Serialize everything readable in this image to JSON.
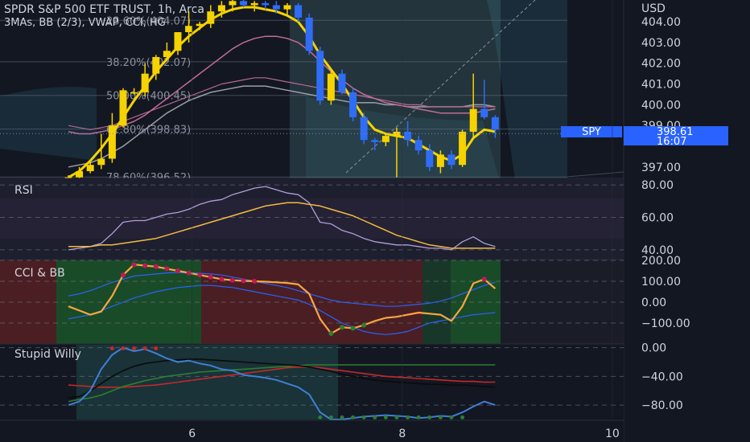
{
  "symbol": {
    "title": "SPDR S&P 500 ETF TRUST, 1h, Arca",
    "indicators": "3MAs, BB (2/3), VWAP, CCI, HG"
  },
  "currency": "USD",
  "price_axis": {
    "labels": [
      "404.00",
      "403.00",
      "402.00",
      "401.00",
      "400.00",
      "399.00",
      "397.00"
    ],
    "values": [
      404,
      403,
      402,
      401,
      400,
      399,
      397
    ],
    "ylim": [
      396.45,
      405.05
    ]
  },
  "fib_levels": [
    {
      "label": "23.60%(404.07)",
      "value": 404.07
    },
    {
      "label": "38.20%(402.07)",
      "value": 402.07
    },
    {
      "label": "50.00%(400.45)",
      "value": 400.45
    },
    {
      "label": "61.80%(398.83)",
      "value": 398.83
    },
    {
      "label": "78.60%(396.52)",
      "value": 396.52
    }
  ],
  "last_price": {
    "ticker": "SPY",
    "price": "398.61",
    "countdown": "16:07",
    "value": 398.61,
    "color": "#2962ff"
  },
  "candles": {
    "up_color": "#f5d300",
    "down_color": "#2f6df6",
    "ohlc": [
      [
        396.3,
        396.6,
        396.0,
        396.5
      ],
      [
        396.5,
        397.0,
        396.3,
        396.8
      ],
      [
        396.8,
        397.3,
        396.7,
        397.1
      ],
      [
        397.1,
        398.6,
        396.9,
        397.4
      ],
      [
        397.4,
        399.6,
        397.2,
        399.0
      ],
      [
        399.0,
        400.8,
        398.9,
        400.7
      ],
      [
        400.6,
        400.8,
        400.5,
        400.6
      ],
      [
        400.6,
        402.0,
        400.4,
        401.5
      ],
      [
        401.5,
        402.4,
        401.2,
        402.3
      ],
      [
        402.3,
        403.0,
        402.1,
        402.6
      ],
      [
        402.6,
        403.5,
        402.4,
        403.5
      ],
      [
        403.5,
        404.5,
        403.0,
        403.8
      ],
      [
        403.8,
        404.0,
        403.6,
        403.9
      ],
      [
        403.9,
        404.8,
        403.7,
        404.5
      ],
      [
        404.5,
        405.0,
        404.2,
        404.8
      ],
      [
        404.8,
        405.1,
        404.5,
        405.0
      ],
      [
        405.0,
        405.1,
        404.7,
        404.8
      ],
      [
        404.8,
        405.0,
        404.5,
        404.9
      ],
      [
        404.9,
        405.0,
        404.6,
        404.8
      ],
      [
        404.8,
        405.0,
        404.4,
        404.6
      ],
      [
        404.6,
        404.9,
        404.3,
        404.8
      ],
      [
        404.8,
        404.9,
        404.0,
        404.2
      ],
      [
        404.2,
        404.4,
        402.4,
        402.6
      ],
      [
        402.6,
        402.8,
        400.0,
        400.2
      ],
      [
        400.2,
        401.6,
        400.0,
        401.5
      ],
      [
        401.5,
        401.7,
        400.5,
        400.6
      ],
      [
        400.6,
        400.8,
        399.2,
        399.4
      ],
      [
        399.4,
        399.6,
        398.1,
        398.3
      ],
      [
        398.3,
        398.4,
        397.8,
        398.2
      ],
      [
        398.2,
        398.6,
        398.0,
        398.5
      ],
      [
        398.5,
        398.9,
        396.5,
        398.7
      ],
      [
        398.7,
        399.2,
        398.0,
        398.3
      ],
      [
        398.3,
        398.5,
        397.6,
        397.8
      ],
      [
        397.8,
        398.1,
        396.8,
        397.0
      ],
      [
        397.0,
        397.8,
        396.7,
        397.6
      ],
      [
        397.6,
        397.8,
        396.9,
        397.1
      ],
      [
        397.1,
        398.8,
        397.0,
        398.7
      ],
      [
        398.7,
        401.5,
        398.4,
        399.8
      ],
      [
        399.8,
        401.2,
        399.3,
        399.4
      ],
      [
        399.4,
        399.5,
        398.4,
        398.8
      ]
    ]
  },
  "overlays": {
    "ma_yellow": [
      396.5,
      396.8,
      397.3,
      397.9,
      398.6,
      399.4,
      400.2,
      400.9,
      401.6,
      402.2,
      402.8,
      403.3,
      403.7,
      404.1,
      404.4,
      404.6,
      404.7,
      404.7,
      404.6,
      404.5,
      404.3,
      404.0,
      403.3,
      402.4,
      401.7,
      401.0,
      400.2,
      399.4,
      398.8,
      398.6,
      398.5,
      398.4,
      398.1,
      397.8,
      397.5,
      397.3,
      397.6,
      398.4,
      398.8,
      398.7
    ],
    "ma_pink": [
      398.7,
      398.6,
      398.6,
      398.7,
      398.8,
      399.0,
      399.2,
      399.5,
      399.9,
      400.3,
      400.7,
      401.1,
      401.5,
      401.9,
      402.3,
      402.7,
      403.0,
      403.2,
      403.3,
      403.3,
      403.2,
      403.0,
      402.6,
      402.1,
      401.6,
      401.2,
      400.8,
      400.5,
      400.3,
      400.1,
      400.0,
      399.9,
      399.8,
      399.7,
      399.6,
      399.6,
      399.6,
      399.6,
      399.7,
      399.8
    ],
    "ma_grey": [
      397.0,
      397.1,
      397.2,
      397.4,
      397.7,
      398.0,
      398.4,
      398.8,
      399.2,
      399.6,
      399.9,
      400.2,
      400.4,
      400.6,
      400.7,
      400.8,
      400.9,
      400.9,
      400.9,
      400.8,
      400.7,
      400.6,
      400.5,
      400.4,
      400.3,
      400.2,
      400.1,
      400.1,
      400.1,
      400.0,
      400.0,
      399.9,
      399.9,
      399.9,
      399.9,
      399.9,
      399.9,
      400.0,
      400.0,
      399.9
    ],
    "ma_pink_dim": [
      399.0,
      398.9,
      398.8,
      398.9,
      399.0,
      399.2,
      399.4,
      399.6,
      399.8,
      400.0,
      400.2,
      400.4,
      400.6,
      400.8,
      401.0,
      401.1,
      401.2,
      401.3,
      401.3,
      401.2,
      401.1,
      401.0,
      400.9,
      400.8,
      400.7,
      400.6,
      400.5,
      400.4,
      400.3,
      400.2,
      400.1,
      400.0,
      400.0,
      399.9,
      399.9,
      399.9,
      399.9,
      399.9,
      399.9,
      399.9
    ]
  },
  "rsi": {
    "title": "RSI",
    "labels": [
      "80.00",
      "60.00",
      "40.00"
    ],
    "values": [
      80,
      60,
      40
    ],
    "ylim": [
      34,
      84
    ],
    "rsi": [
      40,
      41,
      42,
      44,
      50,
      57,
      58,
      58,
      60,
      62,
      63,
      65,
      68,
      70,
      71,
      74,
      76,
      78,
      79,
      77,
      75,
      74,
      69,
      57,
      56,
      52,
      50,
      47,
      45,
      44,
      43,
      43,
      42,
      41,
      41,
      40,
      45,
      48,
      44,
      42
    ],
    "signal": [
      42,
      42,
      42,
      43,
      43,
      44,
      45,
      46,
      47,
      49,
      51,
      53,
      55,
      57,
      59,
      61,
      63,
      65,
      67,
      68,
      69,
      69,
      68,
      67,
      65,
      63,
      61,
      58,
      55,
      52,
      49,
      47,
      45,
      43,
      42,
      41,
      41,
      41,
      41,
      41
    ]
  },
  "cci": {
    "title": "CCI & BB",
    "labels": [
      "200.00",
      "100.00",
      "0.00",
      "−100.00"
    ],
    "values": [
      200,
      100,
      0,
      -100
    ],
    "ylim": [
      -200,
      200
    ],
    "cci": [
      -20,
      -40,
      -60,
      -45,
      30,
      130,
      180,
      175,
      170,
      160,
      150,
      140,
      130,
      120,
      110,
      105,
      102,
      100,
      98,
      95,
      92,
      85,
      40,
      -80,
      -150,
      -120,
      -125,
      -110,
      -90,
      -75,
      -70,
      -60,
      -50,
      -55,
      -60,
      -90,
      -20,
      90,
      110,
      65
    ],
    "bb_upper": [
      30,
      40,
      55,
      75,
      95,
      110,
      125,
      130,
      135,
      140,
      142,
      140,
      138,
      135,
      130,
      120,
      110,
      100,
      90,
      80,
      70,
      55,
      40,
      25,
      10,
      0,
      -5,
      -10,
      -15,
      -20,
      -20,
      -15,
      -10,
      -5,
      5,
      20,
      40,
      60,
      80,
      95
    ],
    "bb_lower": [
      -80,
      -70,
      -60,
      -40,
      -20,
      0,
      20,
      35,
      50,
      60,
      70,
      75,
      80,
      80,
      75,
      70,
      60,
      50,
      40,
      30,
      20,
      10,
      -10,
      -40,
      -70,
      -100,
      -120,
      -140,
      -150,
      -155,
      -150,
      -140,
      -120,
      -100,
      -90,
      -80,
      -70,
      -60,
      -55,
      -50
    ]
  },
  "willy": {
    "title": "Stupid Willy",
    "labels": [
      "0.00",
      "−40.00",
      "−80.00"
    ],
    "values": [
      0,
      -40,
      -80
    ],
    "ylim": [
      -100,
      4
    ],
    "blue": [
      -80,
      -75,
      -60,
      -30,
      -10,
      0,
      -5,
      -2,
      -8,
      -15,
      -20,
      -18,
      -22,
      -25,
      -30,
      -32,
      -38,
      -40,
      -42,
      -45,
      -50,
      -55,
      -65,
      -90,
      -100,
      -100,
      -98,
      -96,
      -95,
      -94,
      -95,
      -96,
      -98,
      -97,
      -95,
      -96,
      -90,
      -82,
      -75,
      -80
    ],
    "black": [
      -70,
      -68,
      -60,
      -50,
      -40,
      -32,
      -26,
      -22,
      -20,
      -18,
      -17,
      -16,
      -16,
      -17,
      -18,
      -19,
      -20,
      -21,
      -22,
      -23,
      -24,
      -25,
      -27,
      -30,
      -33,
      -37,
      -40,
      -43,
      -45,
      -47,
      -48,
      -49,
      -50,
      -51,
      -51,
      -52,
      -52,
      -53,
      -54,
      -55
    ],
    "green": [
      -75,
      -72,
      -70,
      -66,
      -60,
      -54,
      -50,
      -46,
      -43,
      -40,
      -38,
      -36,
      -34,
      -33,
      -32,
      -31,
      -30,
      -29,
      -28,
      -27,
      -26,
      -25,
      -24,
      -24,
      -24,
      -24,
      -24,
      -24,
      -24,
      -24,
      -24,
      -24,
      -24,
      -24,
      -24,
      -24,
      -24,
      -24,
      -24,
      -24
    ],
    "red": [
      -52,
      -53,
      -54,
      -55,
      -55,
      -55,
      -54,
      -53,
      -52,
      -50,
      -48,
      -46,
      -44,
      -42,
      -40,
      -38,
      -36,
      -34,
      -32,
      -30,
      -28,
      -27,
      -27,
      -28,
      -30,
      -32,
      -34,
      -36,
      -38,
      -40,
      -41,
      -42,
      -43,
      -44,
      -45,
      -46,
      -47,
      -47,
      -48,
      -48
    ]
  },
  "time_axis": {
    "labels": [
      "6",
      "8",
      "10"
    ],
    "positions": [
      11.3,
      30.5,
      49.7
    ]
  },
  "colors": {
    "background": "#131722",
    "up": "#f5d300",
    "down": "#2f6df6",
    "last_price": "#2962ff"
  }
}
